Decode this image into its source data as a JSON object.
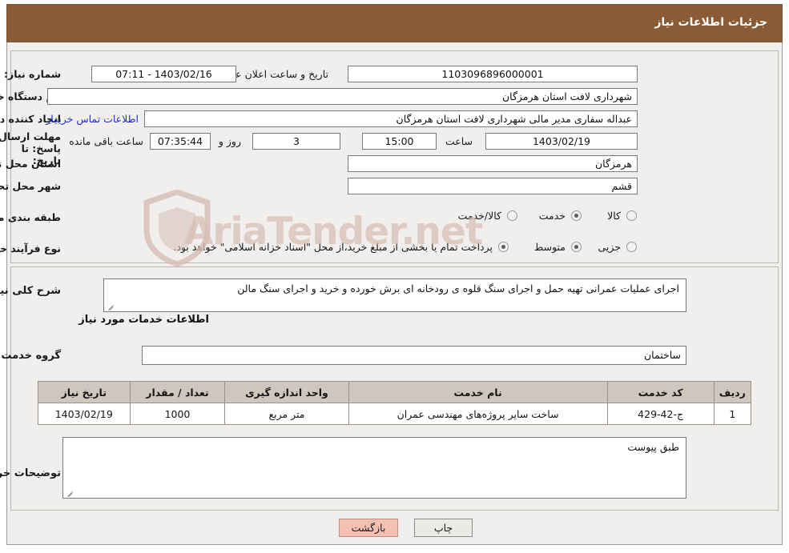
{
  "header": {
    "title": "جزئیات اطلاعات نیاز"
  },
  "watermark": {
    "text": "AriaTender.net",
    "icon": "shield-icon"
  },
  "form": {
    "need_number": {
      "label": "شماره نیاز:",
      "value": "1103096896000001"
    },
    "announce_datetime": {
      "label": "تاریخ و ساعت اعلان عمومی:",
      "value": "1403/02/16 - 07:11"
    },
    "buyer_org": {
      "label": "نام دستگاه خریدار:",
      "value": "شهرداری لافت استان هرمزگان"
    },
    "requester": {
      "label": "ایجاد کننده درخواست:",
      "value": "عبداله سفاری مدیر مالی شهرداری لافت استان هرمزگان"
    },
    "contact_link": {
      "label": "اطلاعات تماس خریدار"
    },
    "deadline": {
      "label": "مهلت ارسال پاسخ: تا تاریخ:",
      "date": "1403/02/19",
      "hour_label": "ساعت",
      "hour": "15:00",
      "days": "3",
      "days_label": "روز و",
      "timer": "07:35:44",
      "remaining_label": "ساعت باقی مانده"
    },
    "delivery_province": {
      "label": "استان محل تحویل:",
      "value": "هرمزگان"
    },
    "delivery_city": {
      "label": "شهر محل تحویل:",
      "value": "قشم"
    },
    "category": {
      "label": "طبقه بندی موضوعی:",
      "options": [
        "کالا",
        "خدمت",
        "کالا/خدمت"
      ],
      "selected": "خدمت"
    },
    "purchase_process": {
      "label": "نوع فرآیند خرید :",
      "options": [
        "جزیی",
        "متوسط"
      ],
      "selected": "متوسط",
      "note": "پرداخت تمام یا بخشی از مبلغ خرید،از محل \"اسناد خزانه اسلامی\" خواهد بود."
    }
  },
  "description": {
    "label": "شرح کلی نیاز:",
    "value": "اجرای عملیات عمرانی تهیه حمل و اجرای سنگ قلوه ی رودخانه ای برش خورده و خرید و اجرای سنگ مالن"
  },
  "services": {
    "section_title": "اطلاعات خدمات مورد نیاز",
    "group_label": "گروه خدمت:",
    "group_value": "ساختمان",
    "columns": [
      "ردیف",
      "کد خدمت",
      "نام خدمت",
      "واحد اندازه گیری",
      "تعداد / مقدار",
      "تاریخ نیاز"
    ],
    "rows": [
      {
        "row": "1",
        "code": "ج-42-429",
        "name": "ساخت سایر پروژه‌های مهندسی عمران",
        "unit": "متر مربع",
        "qty": "1000",
        "date": "1403/02/19"
      }
    ]
  },
  "buyer_notes": {
    "label": "توضیحات خریدار:",
    "value": "طبق پیوست"
  },
  "buttons": {
    "print": "چاپ",
    "back": "بازگشت"
  },
  "colors": {
    "header_bg": "#8a5c36",
    "panel_bg": "#f0efed",
    "table_header_bg": "#cfc7bd",
    "link": "#2230c8",
    "back_button_bg": "#f3c0b2"
  }
}
